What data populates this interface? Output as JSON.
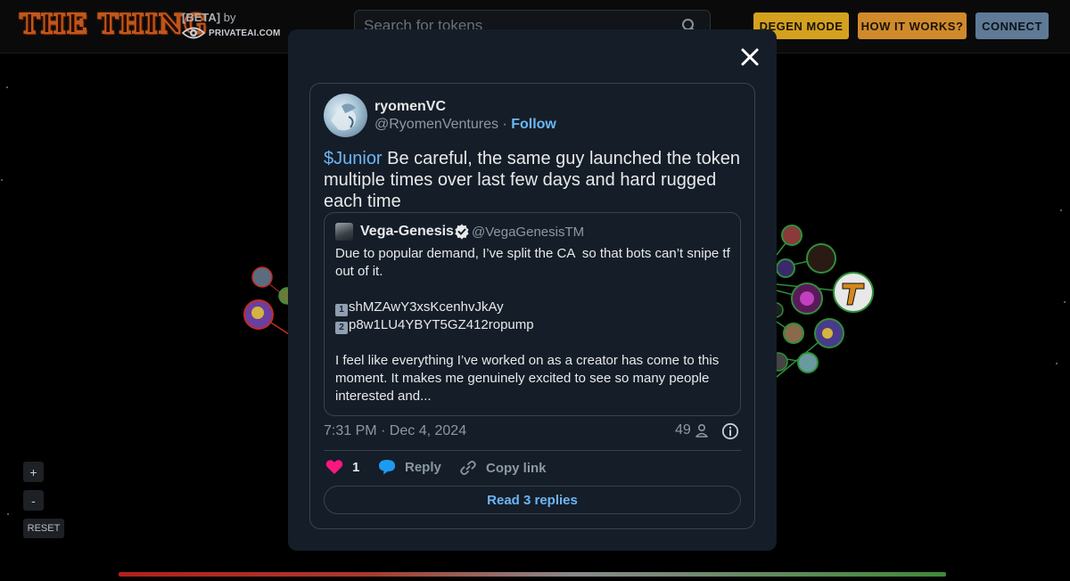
{
  "header": {
    "logo_text": "THE THING",
    "beta_label": "[BETA]",
    "by_label": "by",
    "brand": "PRIVATEAI.COM",
    "search_placeholder": "Search for tokens",
    "buttons": {
      "degen": "DEGEN MODE",
      "how": "HOW IT WORKS?",
      "connect": "CONNECT"
    }
  },
  "controls": {
    "zoom_in": "+",
    "zoom_out": "-",
    "reset": "RESET"
  },
  "tweet": {
    "display_name": "ryomenVC",
    "handle": "@RyomenVentures",
    "separator": "·",
    "follow": "Follow",
    "cashtag": "$Junior",
    "text_rest": " Be careful, the same guy launched the token multiple times over last few days and hard rugged each time",
    "quote": {
      "display_name": "Vega-Genesis",
      "handle": "@VegaGenesisTM",
      "para1": "Due to popular demand, I’ve split the CA  so that bots can’t snipe tf out of it.",
      "key1": "1",
      "addr1": "shMZAwY3xsKcenhvJkAy",
      "key2": "2",
      "addr2": "p8w1LU4YBYT5GZ412ropump",
      "para2": "I feel like everything I’ve worked on as a creator has come to this moment. It makes me genuinely excited to see so many people interested and..."
    },
    "timestamp": "7:31 PM · Dec 4, 2024",
    "view_count": "49",
    "likes": "1",
    "reply_label": "Reply",
    "copy_label": "Copy link",
    "read_replies": "Read 3 replies"
  },
  "colors": {
    "accent_blue": "#6cb6f5",
    "like_pink": "#f91880",
    "degen": "#d4a11f",
    "how": "#d08a2c",
    "connect": "#5e7a96",
    "modal_bg": "#151d28"
  },
  "icons": [
    "search-icon",
    "eye-icon",
    "close-icon",
    "verified-badge-icon",
    "person-icon",
    "info-icon",
    "heart-icon",
    "reply-bubble-icon",
    "link-icon"
  ]
}
